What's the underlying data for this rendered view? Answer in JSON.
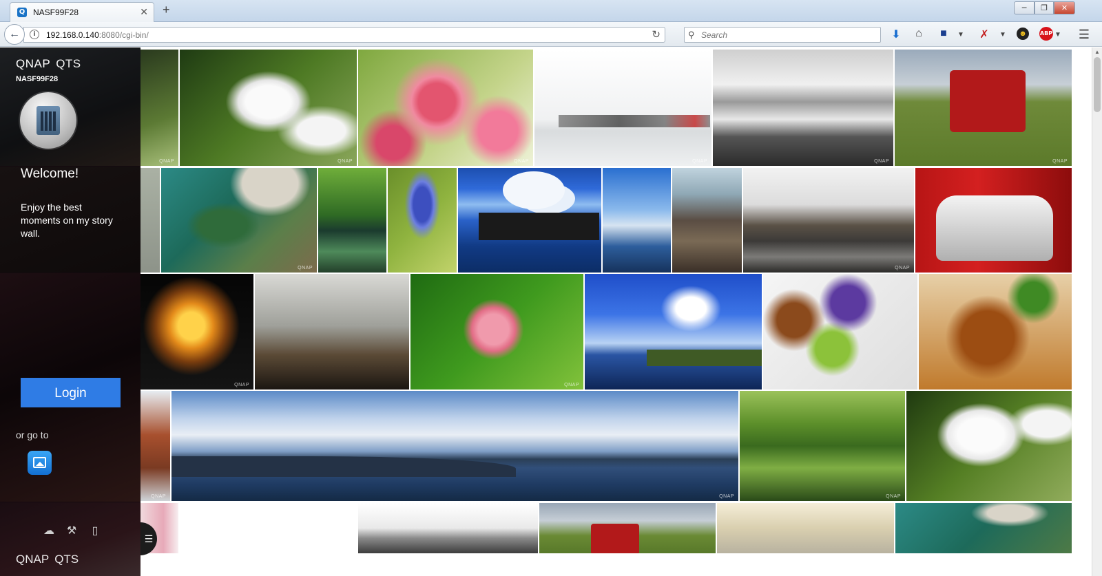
{
  "browser": {
    "tab_title": "NASF99F28",
    "tab_favicon": "Q",
    "url_host": "192.168.0.140",
    "url_rest": ":8080/cgi-bin/",
    "search_placeholder": "Search",
    "window_controls": [
      "minimize",
      "maximize",
      "close"
    ],
    "toolbar_icons": [
      "download-icon",
      "home-icon",
      "save-icon",
      "pdf-icon",
      "extension-icon",
      "adblock-icon",
      "menu-icon"
    ],
    "abp_label": "ABP"
  },
  "sidebar": {
    "brand": "QNAP",
    "product": "QTS",
    "hostname": "NASF99F28",
    "welcome_title": "Welcome!",
    "welcome_text": "Enjoy the best moments on my story wall.",
    "login_label": "Login",
    "goto_label": "or go to",
    "footer_brand": "QNAP",
    "footer_product": "QTS",
    "footer_icons": [
      "cloud-icon",
      "tools-icon",
      "book-icon"
    ]
  },
  "gallery": {
    "watermark": "QNAP",
    "photos": [
      "branch",
      "cyclamen",
      "cherry-blossom",
      "boats-in-fog",
      "bw-seashore",
      "red-tractor",
      "harbor",
      "heart-shaped-weir",
      "green-canal",
      "agapanthus",
      "water-villa",
      "yacht",
      "rock-shore",
      "otaru-canal",
      "audi-racecar",
      "carousel",
      "rainy-window",
      "lotus",
      "blue-sky-cliff",
      "eggplant-dish",
      "curry-dish",
      "brick-building",
      "coast-panorama",
      "tree-reflection",
      "white-cyclamen",
      "pink-blossom",
      "bw-coast",
      "tractor-field",
      "power-lines",
      "heart-weir-2"
    ]
  }
}
